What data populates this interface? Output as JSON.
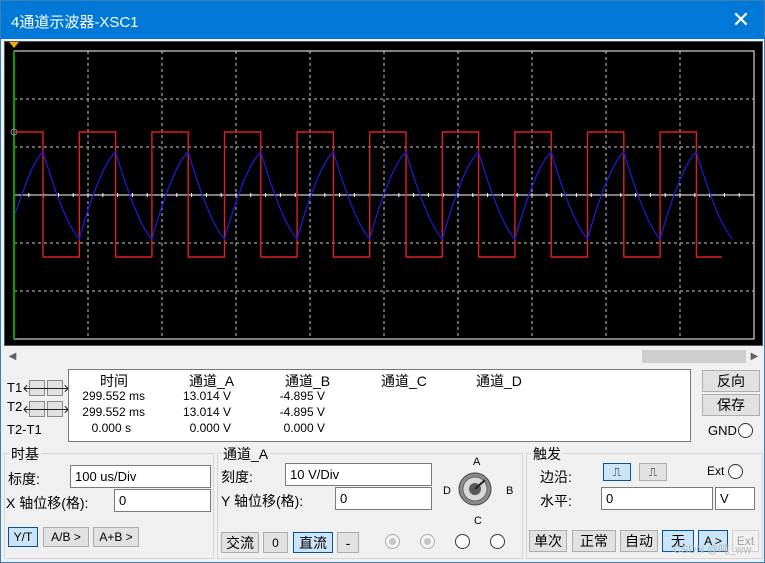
{
  "window": {
    "title": "4通道示波器-XSC1",
    "close_glyph": "✕"
  },
  "scope": {
    "colors": {
      "background": "#000000",
      "grid": "#c8c8c8",
      "frame": "#ffffff",
      "channel_a": "#e02020",
      "channel_b": "#1c1cd0",
      "cursor": "#00a000",
      "marker": "#cc66cc"
    }
  },
  "scrollbar": {
    "left_arrow": "◀",
    "right_arrow": "▶"
  },
  "cursors": {
    "t1_label": "T1",
    "t2_label": "T2",
    "diff_label": "T2-T1",
    "left_arrow": "🡐",
    "right_arrow": "🡒"
  },
  "readout": {
    "headers": [
      "时间",
      "通道_A",
      "通道_B",
      "通道_C",
      "通道_D"
    ],
    "rows": [
      [
        "299.552 ms",
        "13.014 V",
        "-4.895 V"
      ],
      [
        "299.552 ms",
        "13.014 V",
        "-4.895 V"
      ],
      [
        "0.000 s",
        "0.000 V",
        "0.000 V"
      ]
    ]
  },
  "side_buttons": {
    "reverse": "反向",
    "save": "保存",
    "gnd": "GND"
  },
  "timebase": {
    "title": "时基",
    "scale_label": "标度:",
    "scale_value": "100 us/Div",
    "xpos_label": "X 轴位移(格):",
    "xpos_value": "0",
    "modes": [
      "Y/T",
      "A/B >",
      "A+B >"
    ]
  },
  "channel": {
    "title": "通道_A",
    "scale_label": "刻度:",
    "scale_value": "10  V/Div",
    "ypos_label": "Y 轴位移(格):",
    "ypos_value": "0",
    "coupling": [
      "交流",
      "0",
      "直流",
      "-"
    ],
    "knob_labels": {
      "a": "A",
      "b": "B",
      "c": "C",
      "d": "D"
    }
  },
  "trigger": {
    "title": "触发",
    "edge_label": "边沿:",
    "edge_rise_glyph": "⎍",
    "edge_fall_glyph": "⎍",
    "ext_label": "Ext",
    "level_label": "水平:",
    "level_value": "0",
    "level_unit": "V",
    "modes": [
      "单次",
      "正常",
      "自动",
      "无",
      "A >",
      "Ext"
    ]
  },
  "watermark": "CSDN @吨_ww"
}
